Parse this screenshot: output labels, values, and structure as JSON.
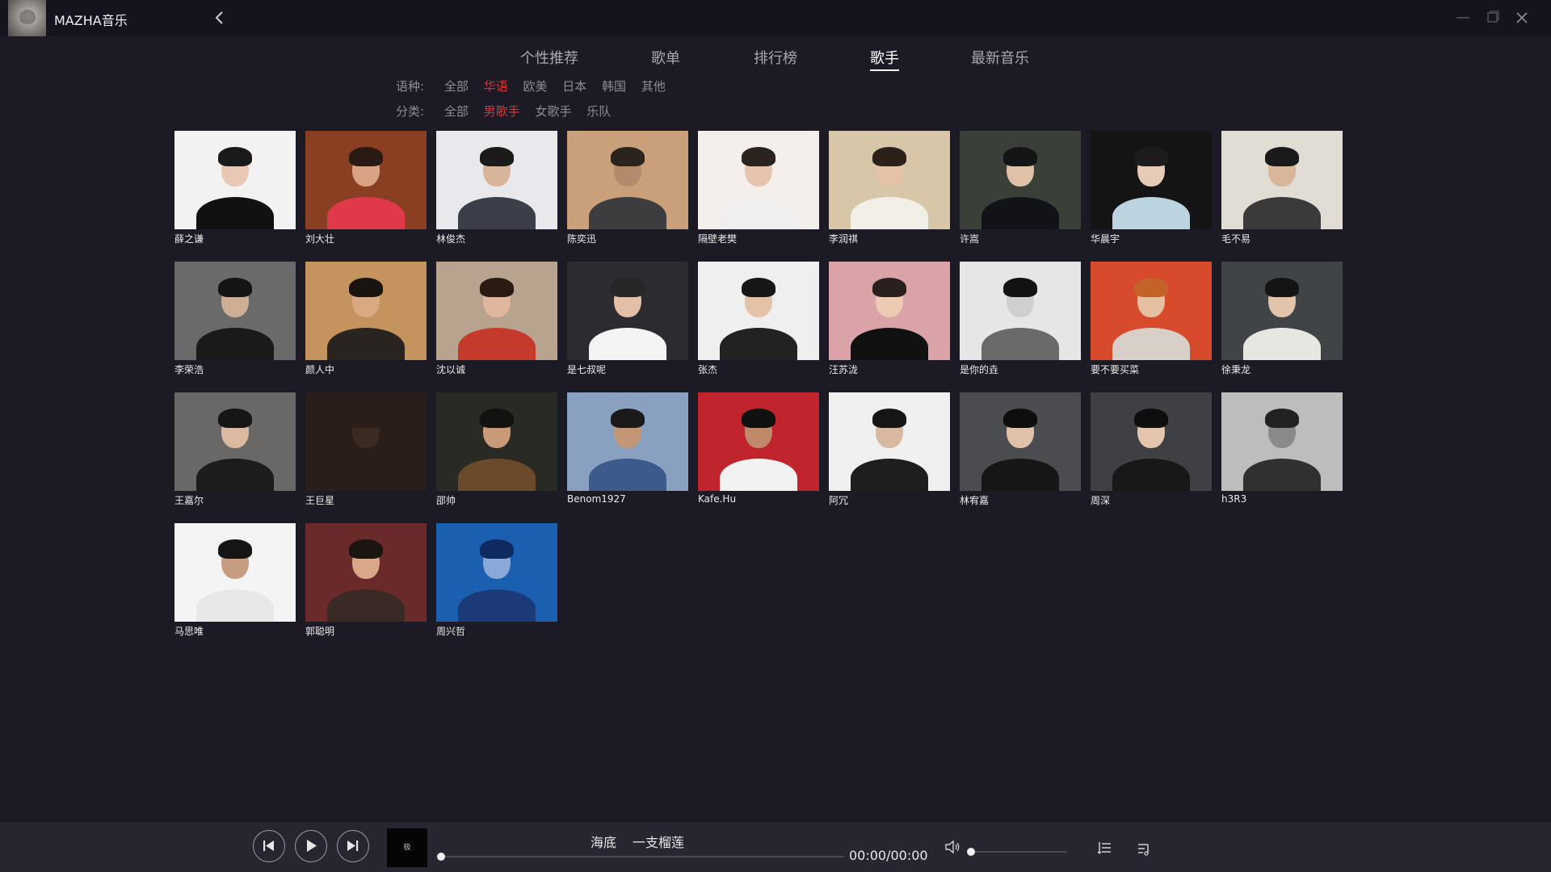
{
  "app": {
    "title": "MAZHA音乐"
  },
  "tabs": [
    {
      "label": "个性推荐",
      "active": false
    },
    {
      "label": "歌单",
      "active": false
    },
    {
      "label": "排行榜",
      "active": false
    },
    {
      "label": "歌手",
      "active": true
    },
    {
      "label": "最新音乐",
      "active": false
    }
  ],
  "filters": {
    "language": {
      "label": "语种:",
      "options": [
        "全部",
        "华语",
        "欧美",
        "日本",
        "韩国",
        "其他"
      ],
      "selected": "华语"
    },
    "category": {
      "label": "分类:",
      "options": [
        "全部",
        "男歌手",
        "女歌手",
        "乐队"
      ],
      "selected": "男歌手"
    }
  },
  "artists": [
    {
      "name": "薛之谦",
      "bg": "#f2f2f2",
      "skin": "#e8c8b4",
      "hair": "#1a1a1a",
      "cloth": "#111111"
    },
    {
      "name": "刘大壮",
      "bg": "#8a3f22",
      "skin": "#d8a484",
      "hair": "#2a1a14",
      "cloth": "#e03a4a"
    },
    {
      "name": "林俊杰",
      "bg": "#e9e8ec",
      "skin": "#d8b49a",
      "hair": "#1b1b1b",
      "cloth": "#3a3f4a"
    },
    {
      "name": "陈奕迅",
      "bg": "#c9a07a",
      "skin": "#b58a6a",
      "hair": "#2b241c",
      "cloth": "#3d3d40"
    },
    {
      "name": "隔壁老樊",
      "bg": "#f4efea",
      "skin": "#e6c4ad",
      "hair": "#2a2320",
      "cloth": "#f0eeee"
    },
    {
      "name": "李润祺",
      "bg": "#d8c6a8",
      "skin": "#e4c3a6",
      "hair": "#2c2118",
      "cloth": "#f2efe8"
    },
    {
      "name": "许嵩",
      "bg": "#3a4038",
      "skin": "#e0c0a6",
      "hair": "#141414",
      "cloth": "#111318"
    },
    {
      "name": "华晨宇",
      "bg": "#141414",
      "skin": "#e6cbb6",
      "hair": "#1c1c1c",
      "cloth": "#bcd3e0"
    },
    {
      "name": "毛不易",
      "bg": "#e2ddd4",
      "skin": "#d8b699",
      "hair": "#1a1a1a",
      "cloth": "#3a3a3a"
    },
    {
      "name": "李荣浩",
      "bg": "#6a6a6a",
      "skin": "#cfae96",
      "hair": "#141414",
      "cloth": "#1a1a1a"
    },
    {
      "name": "颜人中",
      "bg": "#c4935e",
      "skin": "#d8a982",
      "hair": "#1a1410",
      "cloth": "#2a2420"
    },
    {
      "name": "沈以诚",
      "bg": "#b8a48e",
      "skin": "#e0b79c",
      "hair": "#2a1a14",
      "cloth": "#c53a2c"
    },
    {
      "name": "是七叔呢",
      "bg": "#2c2c30",
      "skin": "#e2c0a8",
      "hair": "#262626",
      "cloth": "#f4f4f4"
    },
    {
      "name": "张杰",
      "bg": "#efefef",
      "skin": "#e4c2a8",
      "hair": "#161616",
      "cloth": "#222222"
    },
    {
      "name": "汪苏泷",
      "bg": "#d9a3a8",
      "skin": "#eccab3",
      "hair": "#2a2020",
      "cloth": "#111111"
    },
    {
      "name": "是你的垚",
      "bg": "#e6e6e6",
      "skin": "#cfcfcf",
      "hair": "#121212",
      "cloth": "#6a6a6a"
    },
    {
      "name": "要不要买菜",
      "bg": "#d84a2c",
      "skin": "#e4bfa0",
      "hair": "#c4622a",
      "cloth": "#d8d0c8"
    },
    {
      "name": "徐秉龙",
      "bg": "#404446",
      "skin": "#e2c4ac",
      "hair": "#141414",
      "cloth": "#e8e6e0"
    },
    {
      "name": "王嘉尔",
      "bg": "#6a6866",
      "skin": "#dcbaa2",
      "hair": "#161616",
      "cloth": "#1c1c1c"
    },
    {
      "name": "王巨星",
      "bg": "#2a1e1a",
      "skin": "#3a2a22",
      "hair": "#2a1e1a",
      "cloth": "#2a1e1a"
    },
    {
      "name": "邵帅",
      "bg": "#2a2a24",
      "skin": "#c89a78",
      "hair": "#141210",
      "cloth": "#6a4a2a"
    },
    {
      "name": "Benom1927",
      "bg": "#8aa0c0",
      "skin": "#c49676",
      "hair": "#1a1a1a",
      "cloth": "#3c5a8c"
    },
    {
      "name": "Kafe.Hu",
      "bg": "#c0242c",
      "skin": "#c08a6a",
      "hair": "#111111",
      "cloth": "#f2f2f2"
    },
    {
      "name": "阿冗",
      "bg": "#f0f0f0",
      "skin": "#d8b8a0",
      "hair": "#161616",
      "cloth": "#1e1e1e"
    },
    {
      "name": "林宥嘉",
      "bg": "#4a4c50",
      "skin": "#e0c2aa",
      "hair": "#0e0e0e",
      "cloth": "#161616"
    },
    {
      "name": "周深",
      "bg": "#3e4044",
      "skin": "#e4c6ae",
      "hair": "#0e0e0e",
      "cloth": "#181818"
    },
    {
      "name": "h3R3",
      "bg": "#bdbdbd",
      "skin": "#8a8a8a",
      "hair": "#222222",
      "cloth": "#303030"
    },
    {
      "name": "马思唯",
      "bg": "#f4f4f4",
      "skin": "#c89c80",
      "hair": "#161616",
      "cloth": "#e8e8e8"
    },
    {
      "name": "郭聪明",
      "bg": "#6a2a2a",
      "skin": "#d8a888",
      "hair": "#1c1410",
      "cloth": "#3a2a26"
    },
    {
      "name": "周兴哲",
      "bg": "#1a5fb0",
      "skin": "#8aa8d8",
      "hair": "#0f2a60",
      "cloth": "#1c3a78"
    }
  ],
  "player": {
    "track_title": "海底",
    "track_artist": "一支榴莲",
    "time": "00:00/00:00",
    "progress": 0,
    "volume": 0,
    "cover_text": "极"
  }
}
